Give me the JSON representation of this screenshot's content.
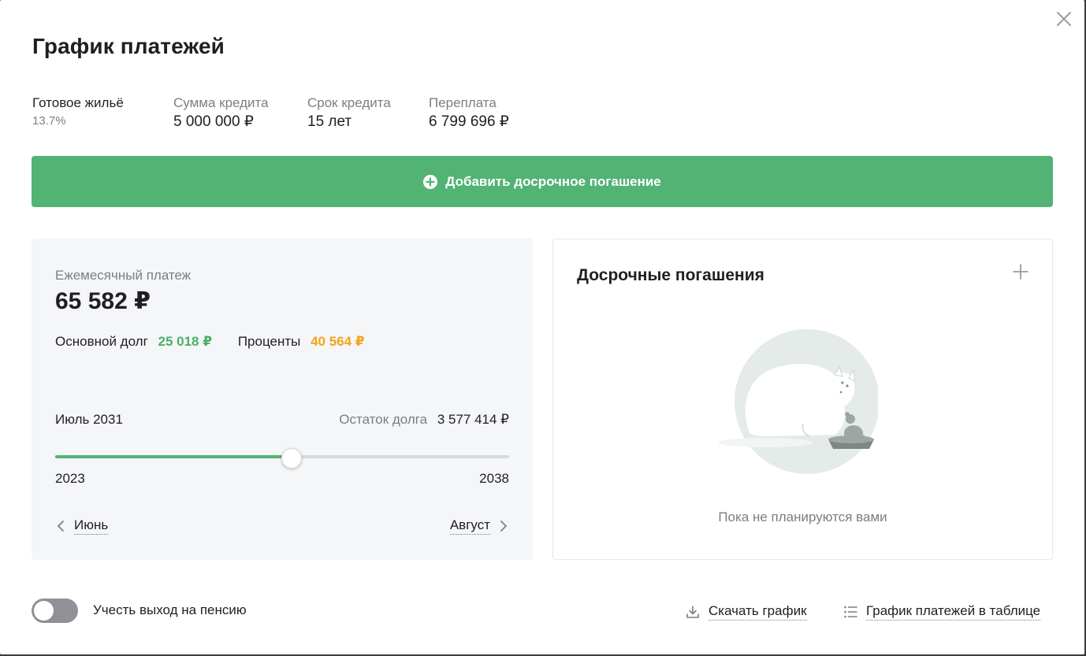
{
  "modal": {
    "title": "График платежей"
  },
  "summary": {
    "product_name": "Готовое жильё",
    "rate": "13.7%",
    "items": [
      {
        "label": "Сумма кредита",
        "value": "5 000 000 ₽"
      },
      {
        "label": "Срок кредита",
        "value": "15 лет"
      },
      {
        "label": "Переплата",
        "value": "6 799 696 ₽"
      }
    ]
  },
  "add_button": {
    "label": "Добавить досрочное погашение",
    "color": "#52b374"
  },
  "payment": {
    "monthly_label": "Ежемесячный платеж",
    "monthly_value": "65 582 ₽",
    "principal_label": "Основной долг",
    "principal_value": "25 018 ₽",
    "interest_label": "Проценты",
    "interest_value": "40 564 ₽",
    "principal_color": "#4caf69",
    "interest_color": "#f2a51b"
  },
  "timeline": {
    "current_date": "Июль 2031",
    "remaining_label": "Остаток долга",
    "remaining_value": "3 577 414 ₽",
    "start_year": "2023",
    "end_year": "2038",
    "progress_fraction": 0.521,
    "prev_month": "Июнь",
    "next_month": "Август"
  },
  "early_repayments": {
    "title": "Досрочные погашения",
    "empty_text": "Пока не планируются вами",
    "illustration_icon": "cat-and-mouse-illustration"
  },
  "footer": {
    "toggle_label": "Учесть выход на пенсию",
    "toggle_on": false,
    "download_label": "Скачать график",
    "table_label": "График платежей в таблице"
  }
}
